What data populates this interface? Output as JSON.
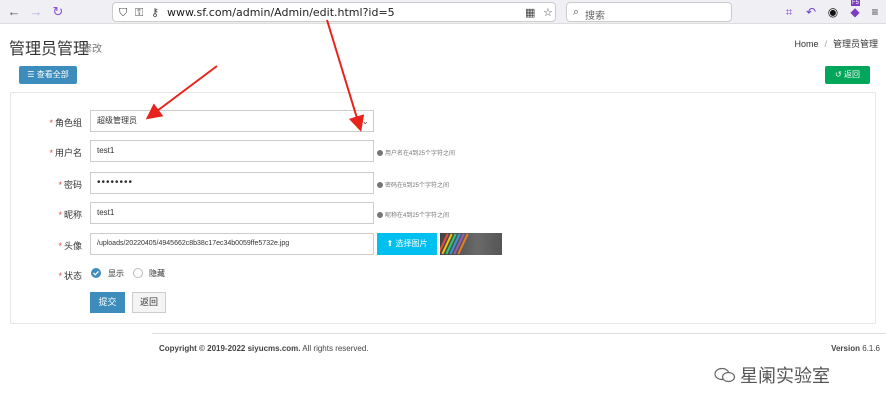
{
  "browser": {
    "url": "www.sf.com/admin/Admin/edit.html?id=5",
    "search_placeholder": "搜索",
    "badge_count": "F5"
  },
  "header": {
    "title": "管理员管理",
    "subtitle": "修改",
    "breadcrumb": [
      "Home",
      "管理员管理"
    ]
  },
  "toolbar": {
    "view_all_label": "查看全部",
    "back_label": "返回"
  },
  "form": {
    "role": {
      "label": "角色组",
      "value": "超级管理员"
    },
    "username": {
      "label": "用户名",
      "value": "test1",
      "help": "用户名在4到25个字符之间"
    },
    "password": {
      "label": "密码",
      "value": "••••••••",
      "help": "密码在6到25个字符之间"
    },
    "nickname": {
      "label": "昵称",
      "value": "test1",
      "help": "昵称在4到25个字符之间"
    },
    "avatar": {
      "label": "头像",
      "value": "/uploads/20220405/4945662c8b38c17ec34b0059ffe5732e.jpg",
      "button": "选择图片"
    },
    "status": {
      "label": "状态",
      "option_show": "显示",
      "option_hide": "隐藏",
      "selected": "显示"
    },
    "submit_label": "提交",
    "return_label": "返回"
  },
  "footer": {
    "copyright_bold": "Copyright © 2019-2022 siyucms.com.",
    "copyright_rest": " All rights reserved.",
    "version_label": "Version",
    "version_value": "6.1.6"
  },
  "watermark": {
    "text": "星阑实验室"
  },
  "colors": {
    "primary": "#3c8dbc",
    "success": "#00a65a",
    "info": "#00c0ef",
    "required": "#dd4b39",
    "annotation_arrow": "#e8231b"
  }
}
